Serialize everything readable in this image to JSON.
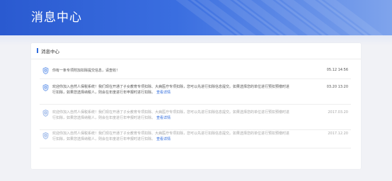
{
  "header": {
    "title": "消息中心"
  },
  "card": {
    "title": "消息中心"
  },
  "colors": {
    "accent": "#2f6bdc",
    "banner": "#3a6ee0",
    "unread_text": "#555555",
    "read_text": "#a6a6a6"
  },
  "messages": [
    {
      "icon": "shield-icon",
      "text": "你有一条专项附加扣除提交信息，请查收！",
      "link": "",
      "time": "05.12 14:56",
      "read": false
    },
    {
      "icon": "shield-icon",
      "text": "欢迎你加入自然人保税系统！我们现在开通了子女教育专项扣除、大病医疗专项扣除，您可以先进行扣除信息提交。如果选择您的单位进行预扣预缴时进行扣除，如果您选择纳税人，则会在年度进行年申报时进行扣除。",
      "link": "查看详情",
      "time": "03.20 13:20",
      "read": false
    },
    {
      "icon": "shield-icon",
      "text": "欢迎你加入自然人保税系统！我们现在开通了子女教育专项扣除、大病医疗专项扣除，您可以先进行扣除信息提交。如果选择您的单位进行预扣预缴时进行扣除，如果您选择纳税人，则会在年度进行年申报时进行扣除。",
      "link": "查看详情",
      "time": "2017.03.20",
      "read": true
    },
    {
      "icon": "shield-icon",
      "text": "欢迎你加入自然人保税系统！我们现在开通了子女教育专项扣除、大病医疗专项扣除，您可以先进行扣除信息提交。如果选择您的单位进行预扣预缴时进行扣除，如果您选择纳税人，则会在年度进行年申报时进行扣除。",
      "link": "查看详情",
      "time": "2017.12.20",
      "read": true
    }
  ]
}
